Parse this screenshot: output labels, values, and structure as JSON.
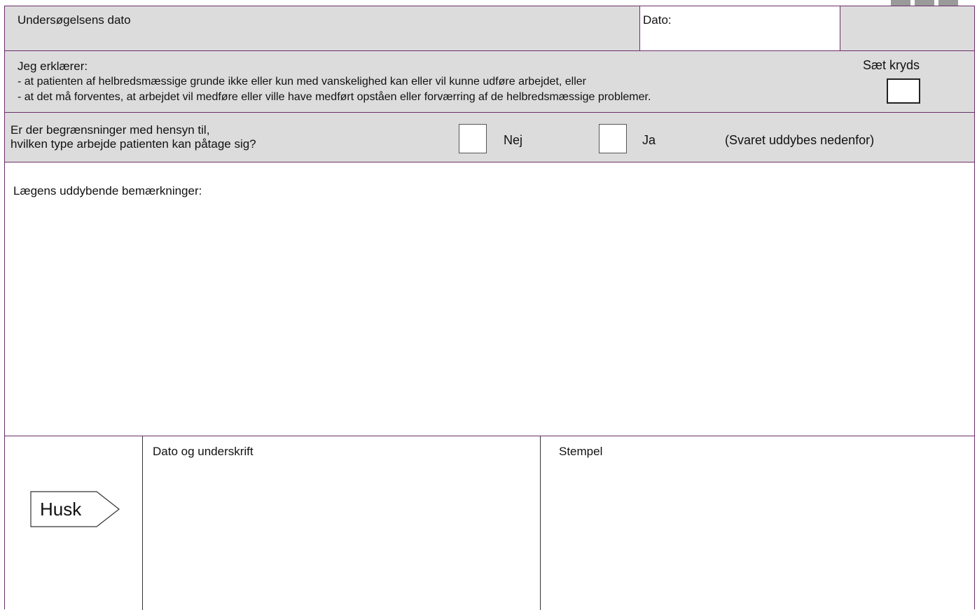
{
  "form": {
    "row_date": {
      "label": "Undersøgelsens dato",
      "dato_label": "Dato:"
    },
    "declaration": {
      "heading": "Jeg erklærer:",
      "line1": "- at patienten af helbredsmæssige grunde ikke eller kun med vanskelighed kan eller vil kunne udføre arbejdet, eller",
      "line2": "- at det må forventes, at arbejdet vil medføre eller ville have medført opståen eller forværring af de helbredsmæssige problemer.",
      "check_label": "Sæt kryds"
    },
    "restrictions": {
      "question_line1": "Er der begrænsninger med hensyn til,",
      "question_line2": "hvilken type arbejde patienten kan påtage sig?",
      "no_label": "Nej",
      "yes_label": "Ja",
      "note": "(Svaret uddybes nedenfor)"
    },
    "remarks": {
      "label": "Lægens uddybende bemærkninger:"
    },
    "footer": {
      "husk_label": "Husk",
      "signature_label": "Dato og underskrift",
      "stamp_label": "Stempel"
    }
  }
}
